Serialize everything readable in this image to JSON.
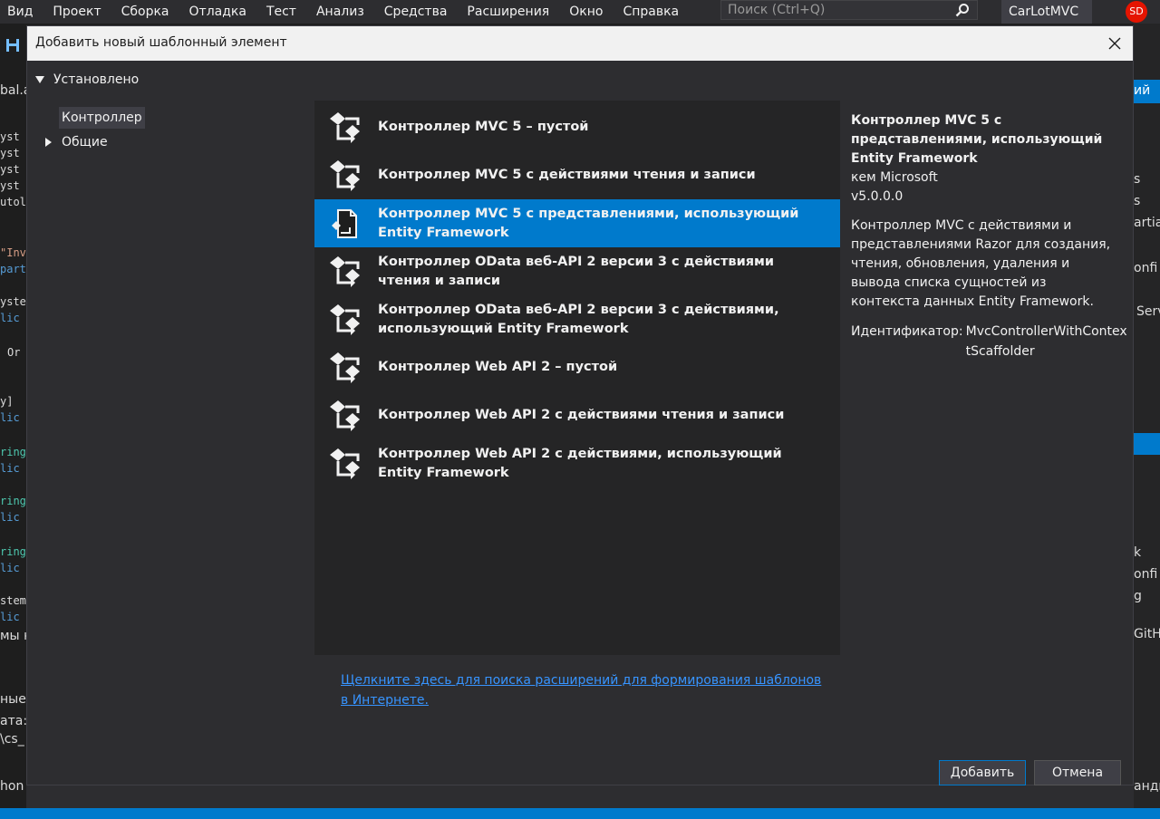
{
  "menubar": {
    "items": [
      "Вид",
      "Проект",
      "Сборка",
      "Отладка",
      "Тест",
      "Анализ",
      "Средства",
      "Расширения",
      "Окно",
      "Справка"
    ],
    "search_placeholder": "Поиск (Ctrl+Q)",
    "project_name": "CarLotMVC",
    "user_initials": "SD"
  },
  "background": {
    "left_fragments": [
      "bal.a",
      "yst",
      "yst",
      "yst",
      "yst",
      "utol",
      "\"Inv",
      "part",
      "ystem",
      "lic",
      "Or",
      "y]",
      "lic",
      "ring",
      "lic",
      "ring",
      "lic",
      "ring",
      "lic",
      "stem",
      "lic",
      "мы н",
      "ные",
      "ата:",
      "\\cs_",
      "hon"
    ],
    "right_fragments": [
      "ий",
      "s",
      "s",
      "artia",
      "onfi",
      "Serv",
      "k",
      "onfi",
      "g",
      "GitH",
      "анди"
    ]
  },
  "dialog": {
    "title": "Добавить новый шаблонный элемент",
    "tree": {
      "root": "Установлено",
      "selected": "Контроллер",
      "general": "Общие"
    },
    "templates": [
      {
        "label": "Контроллер MVC 5 – пустой",
        "icon": "controller-icon",
        "selected": false
      },
      {
        "label": "Контроллер MVC 5 с действиями чтения и записи",
        "icon": "controller-icon",
        "selected": false
      },
      {
        "label": "Контроллер MVC 5 с представлениями, использующий Entity Framework",
        "icon": "document-icon",
        "selected": true
      },
      {
        "label": "Контроллер OData веб-API 2 версии 3 с действиями чтения и записи",
        "icon": "controller-icon",
        "selected": false
      },
      {
        "label": "Контроллер OData веб-API 2 версии 3 с действиями, использующий Entity Framework",
        "icon": "controller-icon",
        "selected": false
      },
      {
        "label": "Контроллер Web API 2 – пустой",
        "icon": "controller-icon",
        "selected": false
      },
      {
        "label": "Контроллер Web API 2 с действиями чтения и записи",
        "icon": "controller-icon",
        "selected": false
      },
      {
        "label": "Контроллер Web API 2 с действиями, использующий Entity Framework",
        "icon": "controller-icon",
        "selected": false
      }
    ],
    "details": {
      "title": "Контроллер MVC 5 с представлениями, использующий Entity Framework",
      "author": "кем Microsoft",
      "version": "v5.0.0.0",
      "description": "Контроллер MVC с действиями и представлениями Razor для создания, чтения, обновления, удаления и вывода списка сущностей из контекста данных Entity Framework.",
      "id_label": "Идентификатор:",
      "id_value": "MvcControllerWithContextScaffolder"
    },
    "extensions_link": "Щелкните здесь для поиска расширений для формирования шаблонов в Интернете.",
    "add_button": "Добавить",
    "cancel_button": "Отмена"
  },
  "colors": {
    "accent": "#007acc",
    "dialog_bg": "#2d2d30",
    "list_bg": "#252526",
    "link": "#3794ff"
  }
}
